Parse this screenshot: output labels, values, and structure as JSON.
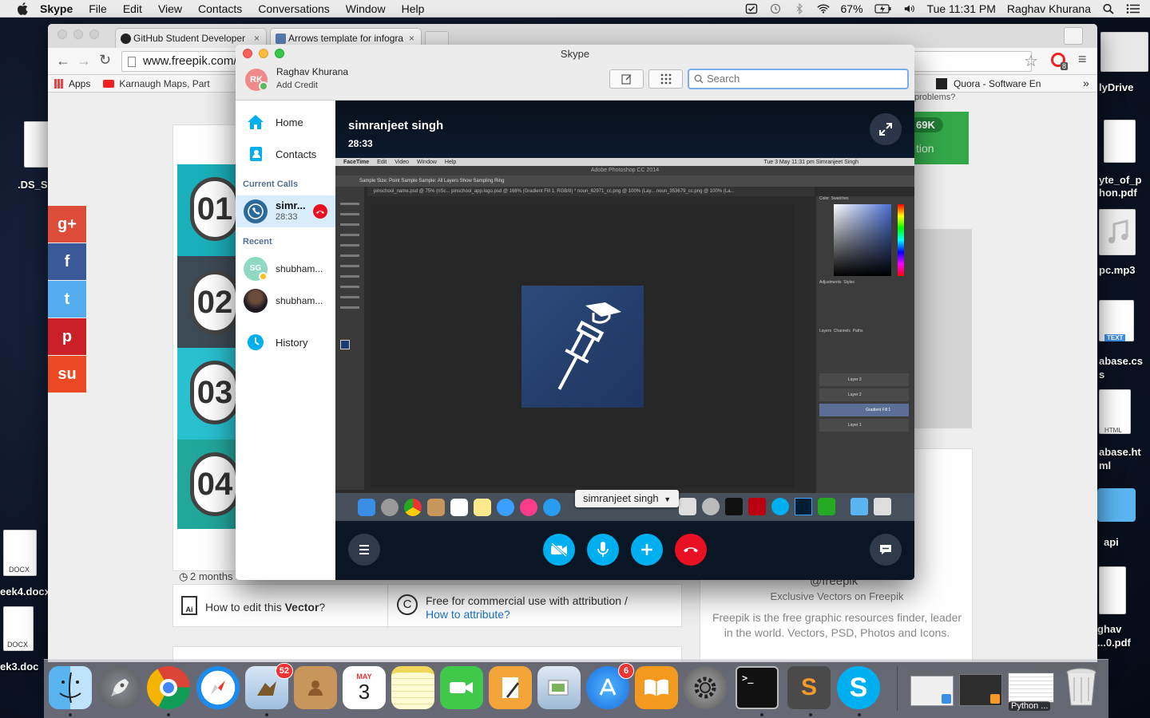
{
  "menubar": {
    "app": "Skype",
    "items": [
      "File",
      "Edit",
      "View",
      "Contacts",
      "Conversations",
      "Window",
      "Help"
    ],
    "battery": "67%",
    "clock": "Tue 11:31 PM",
    "user": "Raghav Khurana"
  },
  "desktop": {
    "files_left": [
      ".DS_S",
      "eek4.docx",
      "ek3.doc"
    ],
    "doc_label": "DOCX",
    "files_right": [
      "lyDrive",
      "yte_of_p\nhon.pdf",
      "pc.mp3",
      "abase.cs\ns",
      "abase.ht\nml",
      "api",
      "ghav\n...0.pdf"
    ],
    "text_badge": "TEXT",
    "html_badge": "HTML"
  },
  "chrome": {
    "tabs": [
      {
        "title": "GitHub Student Developer",
        "close": "×"
      },
      {
        "title": "Arrows template for infogra",
        "close": "×"
      }
    ],
    "url": "www.freepik.com/",
    "bookmarks": [
      "Apps",
      "Karnaugh Maps, Part",
      "Quora - Software En"
    ],
    "bookmark_more": "»",
    "opera_badge": "8",
    "page": {
      "social": [
        "g+",
        "f",
        "t",
        "p",
        "su"
      ],
      "numbers": [
        "01",
        "02",
        "03",
        "04"
      ],
      "time_ago": "2 months",
      "edit_prefix": "How to edit this ",
      "edit_bold": "Vector",
      "edit_suffix": "?",
      "license_line1": "Free for commercial use with attribution /",
      "license_link": "How to attribute?",
      "problems": "problems?",
      "follow_count": "69K",
      "follow_label": "tion",
      "freepik_handle": "@freepik",
      "freepik_tag": "Exclusive Vectors on Freepik",
      "freepik_desc": "Freepik is the free graphic resources finder, leader in the world. Vectors, PSD, Photos and Icons."
    }
  },
  "skype": {
    "window_title": "Skype",
    "user_initials": "RK",
    "user_name": "Raghav Khurana",
    "add_credit": "Add Credit",
    "search_placeholder": "Search",
    "nav": {
      "home": "Home",
      "contacts": "Contacts",
      "history": "History"
    },
    "current_calls_label": "Current Calls",
    "current_call": {
      "name": "simr...",
      "duration": "28:33"
    },
    "recent_label": "Recent",
    "recent": [
      {
        "name": "shubham...",
        "initials": "SG"
      },
      {
        "name": "shubham..."
      }
    ],
    "call": {
      "caller": "simranjeet singh",
      "duration": "28:33",
      "participant_tag": "simranjeet singh"
    },
    "shared_screen": {
      "menubar": [
        "FaceTime",
        "Edit",
        "Video",
        "Window",
        "Help"
      ],
      "menubar_right": "Tue 3 May  11:31 pm   Simranjeet Singh",
      "app_title": "Adobe Photoshop CC 2014",
      "options": "Sample Size:  Point Sample     Sample:  All Layers     Show Sampling Ring",
      "doc_tabs": "pinschool_name.psd @ 75% (nSc...    pinschool_app.logo.psd @ 168% (Gradient Fill 1, RGB/8) *    noun_62971_cc.png @ 100% (Lay...    noun_353679_cc.png @ 100% (La...",
      "layers": [
        "Layer 3",
        "Layer 2",
        "Gradient Fill 1",
        "Layer 1"
      ],
      "panel_tabs": [
        "Color",
        "Swatches",
        "Adjustments",
        "Styles",
        "Layers",
        "Channels",
        "Paths"
      ]
    }
  },
  "dock": {
    "mail_badge": "52",
    "calendar_month": "MAY",
    "calendar_day": "3",
    "appstore_badge": "6",
    "python_label": "Python ..."
  },
  "colors": {
    "skype_blue": "#00aff0",
    "hangup_red": "#e81123",
    "accent_link": "#1a73c8"
  }
}
